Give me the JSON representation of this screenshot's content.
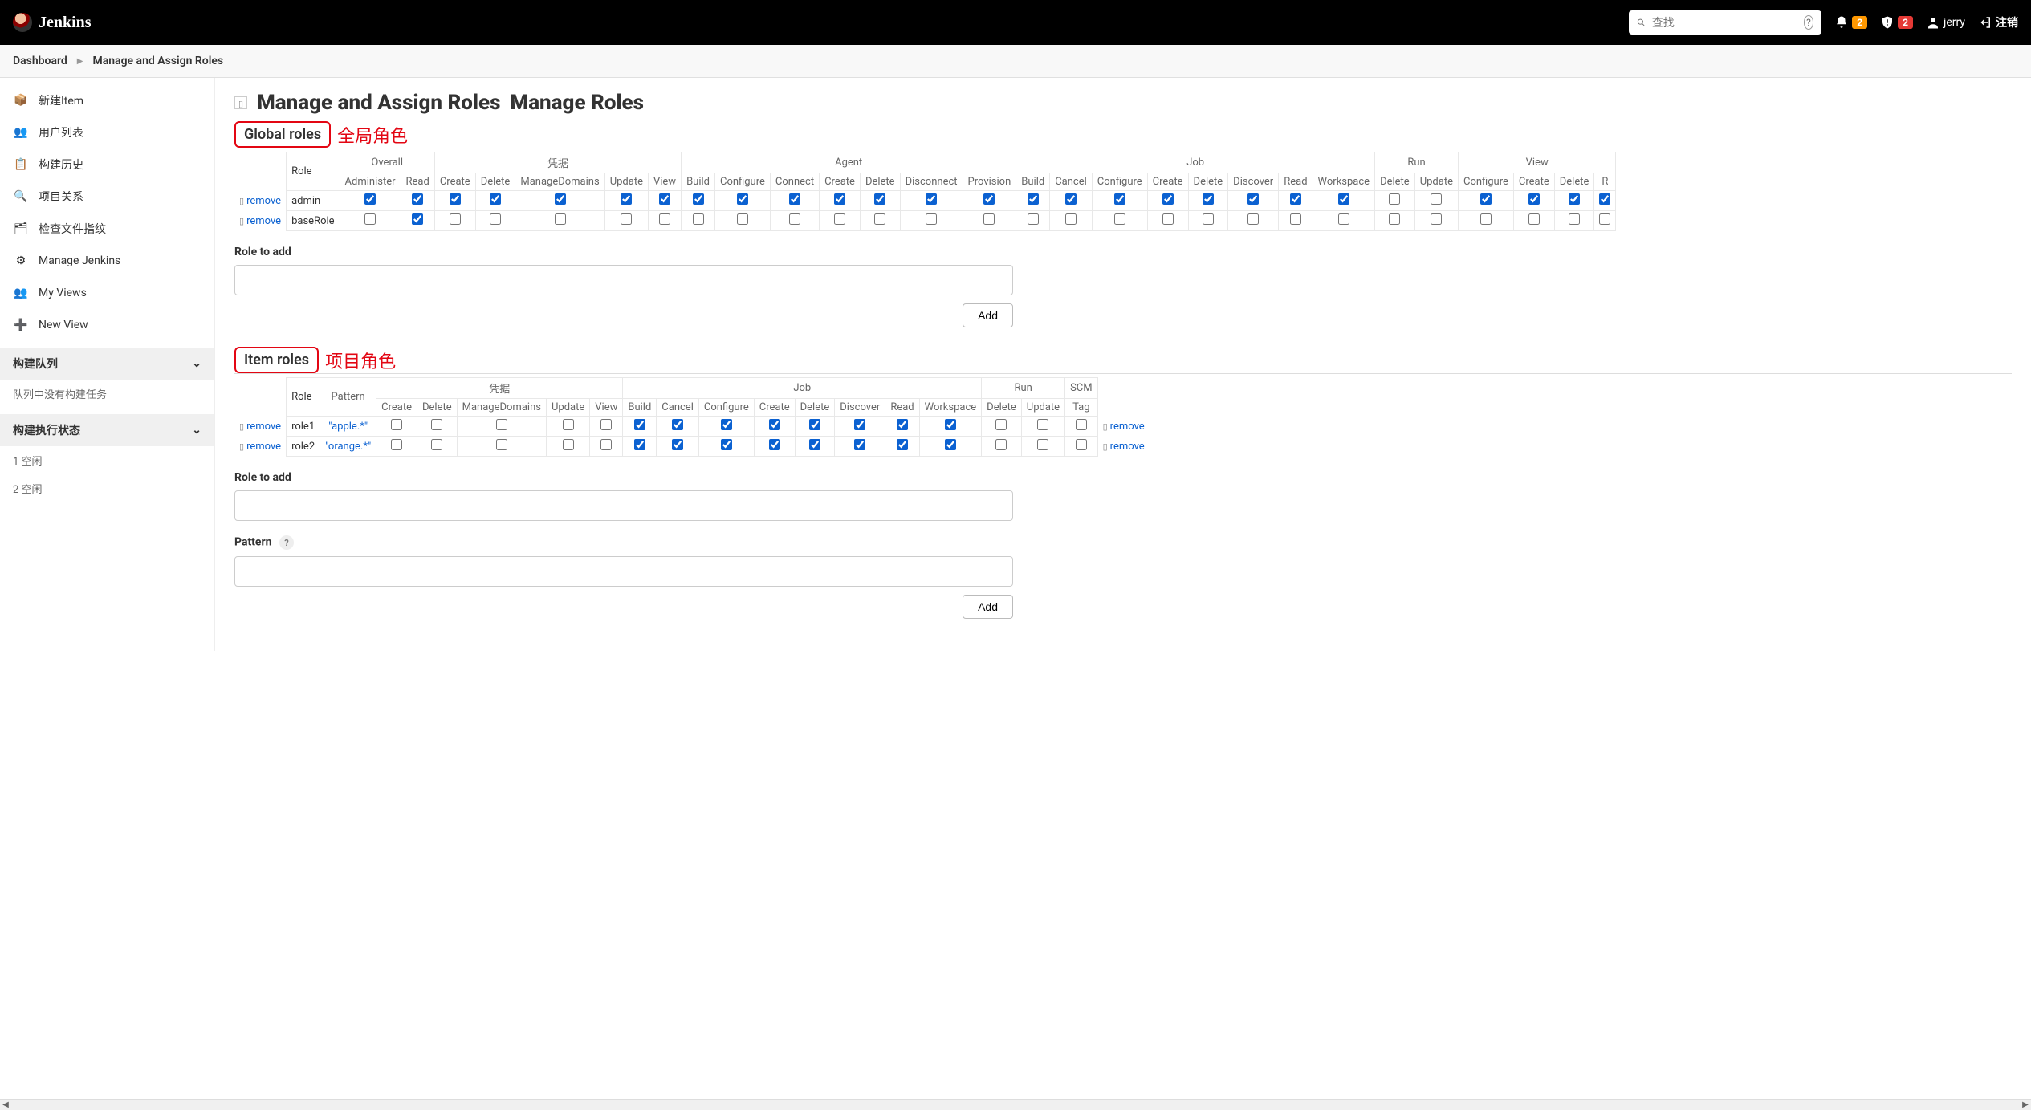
{
  "header": {
    "brand": "Jenkins",
    "search_placeholder": "查找",
    "notif_badge": "2",
    "alert_badge": "2",
    "user": "jerry",
    "logout": "注销"
  },
  "breadcrumbs": [
    {
      "label": "Dashboard"
    },
    {
      "label": "Manage and Assign Roles"
    }
  ],
  "sidebar": {
    "items": [
      {
        "label": "新建Item",
        "icon": "📦"
      },
      {
        "label": "用户列表",
        "icon": "👥"
      },
      {
        "label": "构建历史",
        "icon": "📋"
      },
      {
        "label": "项目关系",
        "icon": "🔍"
      },
      {
        "label": "检查文件指纹",
        "icon": "🗂"
      },
      {
        "label": "Manage Jenkins",
        "icon": "⚙"
      },
      {
        "label": "My Views",
        "icon": "👥"
      },
      {
        "label": "New View",
        "icon": "➕"
      }
    ],
    "queue_title": "构建队列",
    "queue_empty": "队列中没有构建任务",
    "exec_title": "构建执行状态",
    "exec_items": [
      "1  空闲",
      "2  空闲"
    ]
  },
  "page": {
    "title_part1": "Manage and Assign Roles",
    "title_part2": "Manage Roles",
    "global_section": "Global roles",
    "global_anno": "全局角色",
    "item_section": "Item roles",
    "item_anno": "项目角色",
    "role_to_add": "Role to add",
    "pattern_label": "Pattern",
    "add_btn": "Add",
    "remove_text": "remove",
    "role_header": "Role",
    "pattern_header": "Pattern"
  },
  "global_table": {
    "groups": [
      {
        "name": "Overall",
        "cols": [
          "Administer",
          "Read"
        ]
      },
      {
        "name": "凭据",
        "cols": [
          "Create",
          "Delete",
          "ManageDomains",
          "Update",
          "View"
        ]
      },
      {
        "name": "Agent",
        "cols": [
          "Build",
          "Configure",
          "Connect",
          "Create",
          "Delete",
          "Disconnect",
          "Provision"
        ]
      },
      {
        "name": "Job",
        "cols": [
          "Build",
          "Cancel",
          "Configure",
          "Create",
          "Delete",
          "Discover",
          "Read",
          "Workspace"
        ]
      },
      {
        "name": "Run",
        "cols": [
          "Delete",
          "Update"
        ]
      },
      {
        "name": "View",
        "cols": [
          "Configure",
          "Create",
          "Delete",
          "R"
        ]
      }
    ],
    "rows": [
      {
        "role": "admin",
        "checks": [
          true,
          true,
          true,
          true,
          true,
          true,
          true,
          true,
          true,
          true,
          true,
          true,
          true,
          true,
          true,
          true,
          true,
          true,
          true,
          true,
          true,
          true,
          false,
          false,
          true,
          true,
          true,
          true
        ]
      },
      {
        "role": "baseRole",
        "checks": [
          false,
          true,
          false,
          false,
          false,
          false,
          false,
          false,
          false,
          false,
          false,
          false,
          false,
          false,
          false,
          false,
          false,
          false,
          false,
          false,
          false,
          false,
          false,
          false,
          false,
          false,
          false,
          false
        ]
      }
    ]
  },
  "item_table": {
    "groups": [
      {
        "name": "凭据",
        "cols": [
          "Create",
          "Delete",
          "ManageDomains",
          "Update",
          "View"
        ]
      },
      {
        "name": "Job",
        "cols": [
          "Build",
          "Cancel",
          "Configure",
          "Create",
          "Delete",
          "Discover",
          "Read",
          "Workspace"
        ]
      },
      {
        "name": "Run",
        "cols": [
          "Delete",
          "Update"
        ]
      },
      {
        "name": "SCM",
        "cols": [
          "Tag"
        ]
      }
    ],
    "rows": [
      {
        "role": "role1",
        "pattern": "\"apple.*\"",
        "checks": [
          false,
          false,
          false,
          false,
          false,
          true,
          true,
          true,
          true,
          true,
          true,
          true,
          true,
          false,
          false,
          false
        ]
      },
      {
        "role": "role2",
        "pattern": "\"orange.*\"",
        "checks": [
          false,
          false,
          false,
          false,
          false,
          true,
          true,
          true,
          true,
          true,
          true,
          true,
          true,
          false,
          false,
          false
        ]
      }
    ]
  }
}
